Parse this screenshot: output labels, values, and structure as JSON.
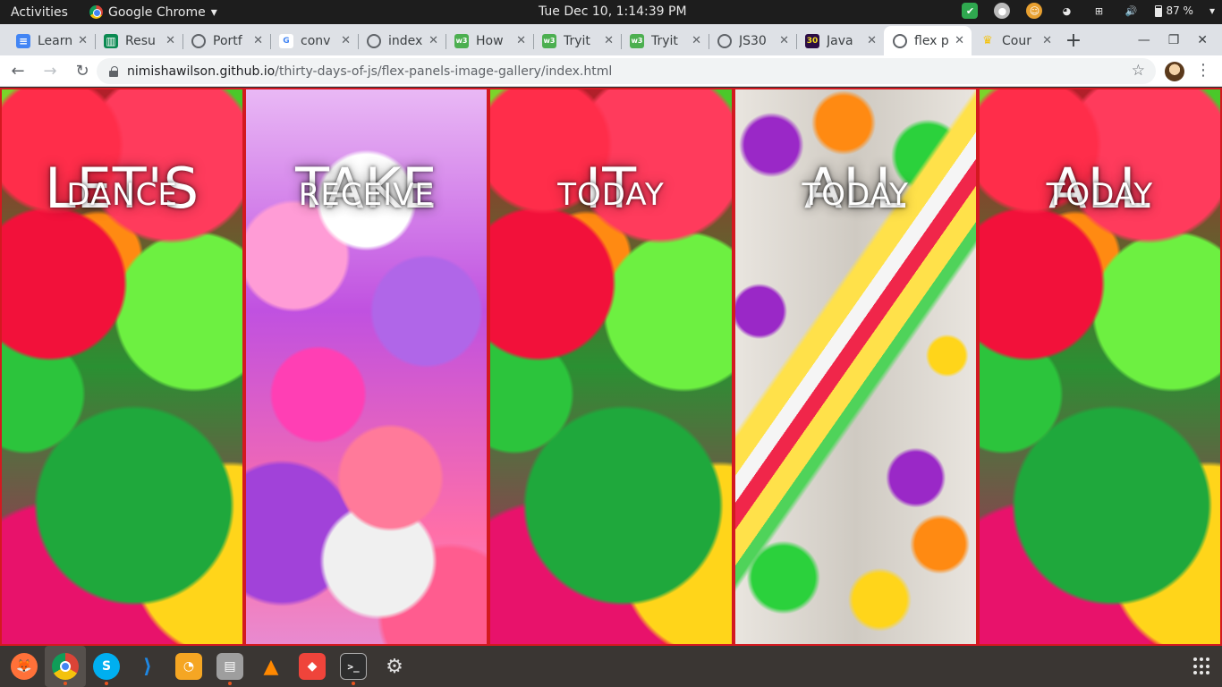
{
  "topbar": {
    "activities": "Activities",
    "app_name": "Google Chrome",
    "app_menu_arrow": "▾",
    "clock": "Tue Dec 10,  1:14:39 PM",
    "battery": "87 %"
  },
  "tabs": [
    {
      "label": "Learn",
      "favicon": "docs-icon",
      "color": "#4285f4",
      "active": false
    },
    {
      "label": "Resu",
      "favicon": "trello-icon",
      "color": "#0b8a52",
      "active": false
    },
    {
      "label": "Portf",
      "favicon": "globe-icon",
      "color": "#5f6368",
      "active": false
    },
    {
      "label": "conv",
      "favicon": "google-icon",
      "color": "#ffffff",
      "active": false
    },
    {
      "label": "index",
      "favicon": "globe-icon",
      "color": "#5f6368",
      "active": false
    },
    {
      "label": "How",
      "favicon": "w3schools-icon",
      "color": "#4caf50",
      "active": false
    },
    {
      "label": "Tryit",
      "favicon": "w3schools-icon",
      "color": "#4caf50",
      "active": false
    },
    {
      "label": "Tryit",
      "favicon": "w3schools-icon",
      "color": "#4caf50",
      "active": false
    },
    {
      "label": "JS30",
      "favicon": "globe-icon",
      "color": "#5f6368",
      "active": false
    },
    {
      "label": "Java",
      "favicon": "javascript30-icon",
      "color": "#2b0c44",
      "active": false
    },
    {
      "label": "flex p",
      "favicon": "globe-icon",
      "color": "#5f6368",
      "active": true
    },
    {
      "label": "Cour",
      "favicon": "crown-icon",
      "color": "#f4c20d",
      "active": false
    }
  ],
  "toolbar": {
    "url_host": "nimishawilson.github.io",
    "url_path": "/thirty-days-of-js/flex-panels-image-gallery/index.html"
  },
  "panels": [
    {
      "word": "LET'S",
      "sub": "DANCE",
      "image": "jelly"
    },
    {
      "word": "TAKE",
      "sub": "RECEIVE",
      "image": "marsh"
    },
    {
      "word": "IT",
      "sub": "TODAY",
      "image": "jelly"
    },
    {
      "word": "ALL",
      "sub": "TODAY",
      "image": "candy"
    },
    {
      "word": "ALL",
      "sub": "TODAY",
      "image": "jelly"
    }
  ],
  "dock": [
    {
      "name": "firefox-icon",
      "color": "#ff7139",
      "glyph": "🦊",
      "running": false
    },
    {
      "name": "chrome-icon",
      "color": "#4285f4",
      "glyph": "",
      "running": true
    },
    {
      "name": "skype-icon",
      "color": "#00aff0",
      "glyph": "S",
      "running": true
    },
    {
      "name": "vscode-icon",
      "color": "#1e88e5",
      "glyph": "⟩",
      "running": false
    },
    {
      "name": "blender-icon",
      "color": "#f5a623",
      "glyph": "◔",
      "running": false
    },
    {
      "name": "files-icon",
      "color": "#9e9e9e",
      "glyph": "▤",
      "running": true
    },
    {
      "name": "vlc-icon",
      "color": "#ff8800",
      "glyph": "▲",
      "running": false
    },
    {
      "name": "anydesk-icon",
      "color": "#ef443b",
      "glyph": "◆",
      "running": false
    },
    {
      "name": "terminal-icon",
      "color": "#2d2d2d",
      "glyph": ">_",
      "running": true
    },
    {
      "name": "software-updater-icon",
      "color": "#dddddd",
      "glyph": "⚙",
      "running": false
    }
  ]
}
